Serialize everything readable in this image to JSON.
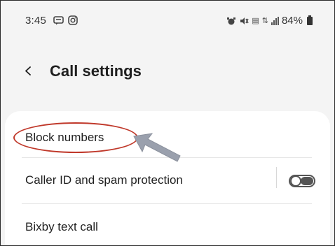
{
  "status": {
    "time": "3:45",
    "battery": "84%",
    "left_icons": [
      "message-icon",
      "instagram-icon"
    ],
    "right_icons": [
      "alarm-icon",
      "mute-icon",
      "volte-icon",
      "4g-icon",
      "signal-icon",
      "battery-icon"
    ]
  },
  "header": {
    "title": "Call settings",
    "back_icon": "chevron-left-icon"
  },
  "settings": {
    "items": [
      {
        "label": "Block numbers"
      },
      {
        "label": "Caller ID and spam protection",
        "toggle": false
      },
      {
        "label": "Bixby text call"
      }
    ]
  },
  "annotation": {
    "highlight_color": "#c0392b",
    "arrow_color": "#9aa0ad"
  }
}
